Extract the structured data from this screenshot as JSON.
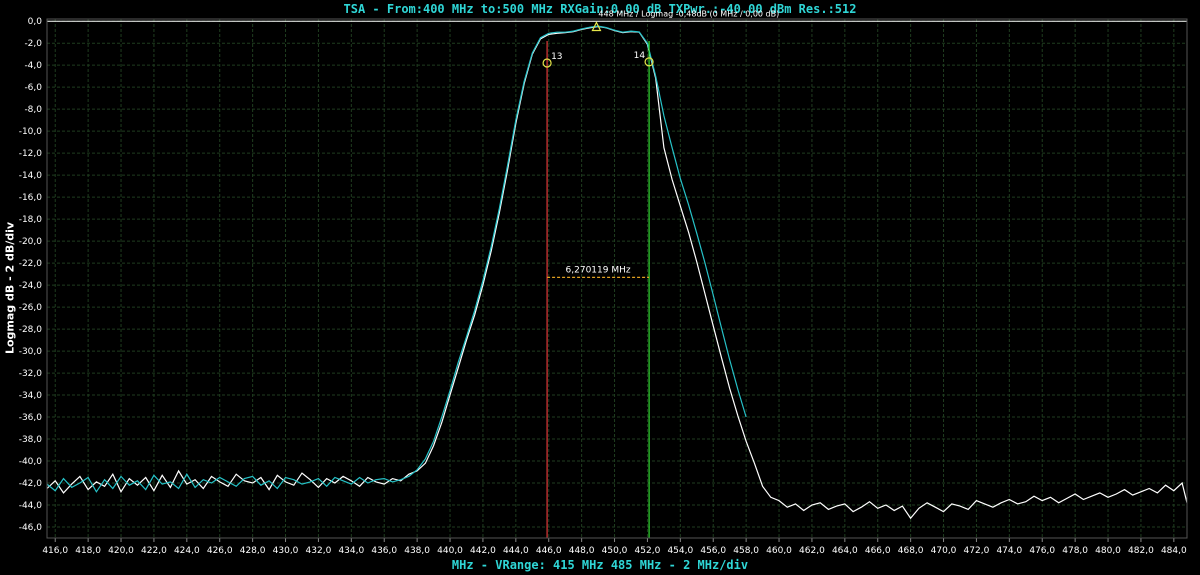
{
  "header": {
    "title": "TSA - From:400 MHz to:500 MHz RXGain:0.00 dB TXPwr.:-40.00 dBm Res.:512"
  },
  "footer": {
    "xlabel": "MHz - VRange: 415 MHz 485 MHz - 2 MHz/div"
  },
  "colors": {
    "background": "#000000",
    "grid": "#1f3d1f",
    "trace_primary": "#ffffff",
    "trace_secondary": "#26c2c8",
    "marker_left": "#e03a3a",
    "marker_right": "#33dd33",
    "marker_symbol": "#e6e64a",
    "bandwidth": "#e0a020",
    "reference_line": "#ffffff",
    "title_text": "#2fd6d6"
  },
  "chart_data": {
    "type": "line",
    "title": "TSA - From:400 MHz to:500 MHz RXGain:0.00 dB TXPwr.:-40.00 dBm Res.:512",
    "xlabel": "MHz - VRange: 415 MHz 485 MHz - 2 MHz/div",
    "ylabel": "Logmag dB - 2 dB/div",
    "xlim": [
      415.5,
      484.8
    ],
    "ylim": [
      -47,
      0.2
    ],
    "grid": true,
    "x_ticks": [
      "416,0",
      "418,0",
      "420,0",
      "422,0",
      "424,0",
      "426,0",
      "428,0",
      "430,0",
      "432,0",
      "434,0",
      "436,0",
      "438,0",
      "440,0",
      "442,0",
      "444,0",
      "446,0",
      "448,0",
      "450,0",
      "452,0",
      "454,0",
      "456,0",
      "458,0",
      "460,0",
      "462,0",
      "464,0",
      "466,0",
      "468,0",
      "470,0",
      "472,0",
      "474,0",
      "476,0",
      "478,0",
      "480,0",
      "482,0",
      "484,0"
    ],
    "y_ticks": [
      "0,0",
      "-2,0",
      "-4,0",
      "-6,0",
      "-8,0",
      "-10,0",
      "-12,0",
      "-14,0",
      "-16,0",
      "-18,0",
      "-20,0",
      "-22,0",
      "-24,0",
      "-26,0",
      "-28,0",
      "-30,0",
      "-32,0",
      "-34,0",
      "-36,0",
      "-38,0",
      "-40,0",
      "-42,0",
      "-44,0",
      "-46,0"
    ],
    "series": [
      {
        "x": [
          415.5,
          416,
          416.5,
          417,
          417.5,
          418,
          418.5,
          419,
          419.5,
          420,
          420.5,
          421,
          421.5,
          422,
          422.5,
          423,
          423.5,
          424,
          424.5,
          425,
          425.5,
          426,
          426.5,
          427,
          427.5,
          428,
          428.5,
          429,
          429.5,
          430,
          430.5,
          431,
          431.5,
          432,
          432.5,
          433,
          433.5,
          434,
          434.5,
          435,
          435.5,
          436,
          436.5,
          437,
          437.5,
          438,
          438.5,
          439,
          439.5,
          440,
          440.5,
          441,
          441.5,
          442,
          442.5,
          443,
          443.5,
          444,
          444.5,
          445,
          445.5,
          446,
          446.5,
          447,
          447.5,
          448,
          448.5,
          449,
          449.5,
          450,
          450.5,
          451,
          451.5,
          452,
          452.5,
          453,
          453.5,
          454,
          454.5,
          455,
          455.5,
          456,
          456.5,
          457,
          457.5,
          458,
          458.5,
          459,
          459.5,
          460,
          460.5,
          461,
          461.5,
          462,
          462.5,
          463,
          463.5,
          464,
          464.5,
          465,
          465.5,
          466,
          466.5,
          467,
          467.5,
          468,
          468.5,
          469,
          469.5,
          470,
          470.5,
          471,
          471.5,
          472,
          472.5,
          473,
          473.5,
          474,
          474.5,
          475,
          475.5,
          476,
          476.5,
          477,
          477.5,
          478,
          478.5,
          479,
          479.5,
          480,
          480.5,
          481,
          481.5,
          482,
          482.5,
          483,
          483.5,
          484,
          484.5,
          484.8
        ],
        "y": [
          -42.5,
          -41.8,
          -42.9,
          -42.1,
          -41.4,
          -42.6,
          -41.9,
          -42.3,
          -41.2,
          -42.8,
          -41.6,
          -42.2,
          -41.5,
          -42.7,
          -41.3,
          -42.4,
          -40.9,
          -42.1,
          -41.7,
          -42.5,
          -41.4,
          -41.9,
          -42.3,
          -41.2,
          -41.8,
          -42.0,
          -41.5,
          -42.6,
          -41.3,
          -41.9,
          -42.2,
          -41.1,
          -41.7,
          -42.4,
          -41.6,
          -42.0,
          -41.4,
          -41.8,
          -42.3,
          -41.5,
          -41.9,
          -42.1,
          -41.6,
          -41.8,
          -41.2,
          -40.9,
          -40.2,
          -38.6,
          -36.5,
          -34.0,
          -31.5,
          -29.0,
          -26.7,
          -24.0,
          -20.9,
          -17.4,
          -13.5,
          -9.3,
          -5.7,
          -3.0,
          -1.6,
          -1.2,
          -1.1,
          -1.05,
          -0.95,
          -0.75,
          -0.6,
          -0.48,
          -0.6,
          -0.85,
          -1.05,
          -0.95,
          -1.0,
          -2.1,
          -5.2,
          -11.5,
          -14.4,
          -16.8,
          -19.2,
          -21.9,
          -24.8,
          -27.7,
          -30.6,
          -33.4,
          -35.9,
          -38.2,
          -40.2,
          -42.3,
          -43.3,
          -43.6,
          -44.2,
          -43.9,
          -44.5,
          -44.0,
          -43.8,
          -44.4,
          -44.1,
          -43.9,
          -44.6,
          -44.2,
          -43.7,
          -44.3,
          -44.0,
          -44.5,
          -44.1,
          -45.2,
          -44.3,
          -43.8,
          -44.2,
          -44.6,
          -43.9,
          -44.1,
          -44.4,
          -43.6,
          -43.9,
          -44.2,
          -43.8,
          -43.5,
          -43.9,
          -43.7,
          -43.2,
          -43.6,
          -43.3,
          -43.8,
          -43.4,
          -43.0,
          -43.5,
          -43.2,
          -42.9,
          -43.3,
          -43.0,
          -42.6,
          -43.1,
          -42.8,
          -42.5,
          -42.9,
          -42.2,
          -42.7,
          -42.0,
          -43.8
        ]
      },
      {
        "x": [
          415.5,
          416,
          416.5,
          417,
          417.5,
          418,
          418.5,
          419,
          419.5,
          420,
          420.5,
          421,
          421.5,
          422,
          422.5,
          423,
          423.5,
          424,
          424.5,
          425,
          425.5,
          426,
          426.5,
          427,
          427.5,
          428,
          428.5,
          429,
          429.5,
          430,
          430.5,
          431,
          431.5,
          432,
          432.5,
          433,
          433.5,
          434,
          434.5,
          435,
          435.5,
          436,
          436.5,
          437,
          437.5,
          438,
          438.5,
          439,
          439.5,
          440,
          440.5,
          441,
          441.5,
          442,
          442.5,
          443,
          443.5,
          444,
          444.5,
          445,
          445.5,
          446,
          446.5,
          447,
          447.5,
          448,
          448.5,
          449,
          449.5,
          450,
          450.5,
          451,
          451.5,
          452,
          452.5,
          453,
          453.5,
          454,
          454.5,
          455,
          455.5,
          456,
          456.5,
          457,
          457.5,
          458
        ],
        "y": [
          -42.1,
          -42.7,
          -41.6,
          -42.4,
          -42.0,
          -41.5,
          -42.8,
          -41.7,
          -42.5,
          -41.4,
          -42.2,
          -41.8,
          -42.6,
          -41.3,
          -42.1,
          -41.9,
          -42.5,
          -41.2,
          -42.4,
          -41.7,
          -42.0,
          -41.5,
          -41.9,
          -42.3,
          -41.6,
          -41.4,
          -42.2,
          -41.8,
          -42.5,
          -41.5,
          -41.7,
          -42.1,
          -41.9,
          -41.6,
          -42.3,
          -41.5,
          -41.8,
          -42.1,
          -41.5,
          -42.0,
          -41.7,
          -41.6,
          -41.9,
          -41.7,
          -41.4,
          -40.8,
          -39.8,
          -38.2,
          -36.0,
          -33.6,
          -31.0,
          -28.7,
          -26.3,
          -23.6,
          -20.5,
          -17.0,
          -13.1,
          -9.0,
          -5.5,
          -2.9,
          -1.5,
          -1.1,
          -1.0,
          -1.0,
          -0.9,
          -0.7,
          -0.55,
          -0.45,
          -0.58,
          -0.82,
          -1.0,
          -0.9,
          -0.98,
          -2.0,
          -5.0,
          -8.6,
          -11.5,
          -14.3,
          -16.7,
          -19.3,
          -22.0,
          -24.9,
          -27.9,
          -30.8,
          -33.5,
          -36.0
        ]
      }
    ],
    "markers": [
      {
        "label": "13",
        "x": 445.9,
        "y": -3.8
      },
      {
        "label": "14",
        "x": 452.1,
        "y": -3.7
      }
    ],
    "peak_marker": {
      "x": 448.9,
      "y": -0.48,
      "label": "448 MHz / Logmag -0,48dB (0 MHz / 0,00 dB)"
    },
    "bandwidth": {
      "label": "6,270119 MHz",
      "y": -23.3,
      "x_start": 445.9,
      "x_end": 452.1
    },
    "reference_level": 0.0
  }
}
